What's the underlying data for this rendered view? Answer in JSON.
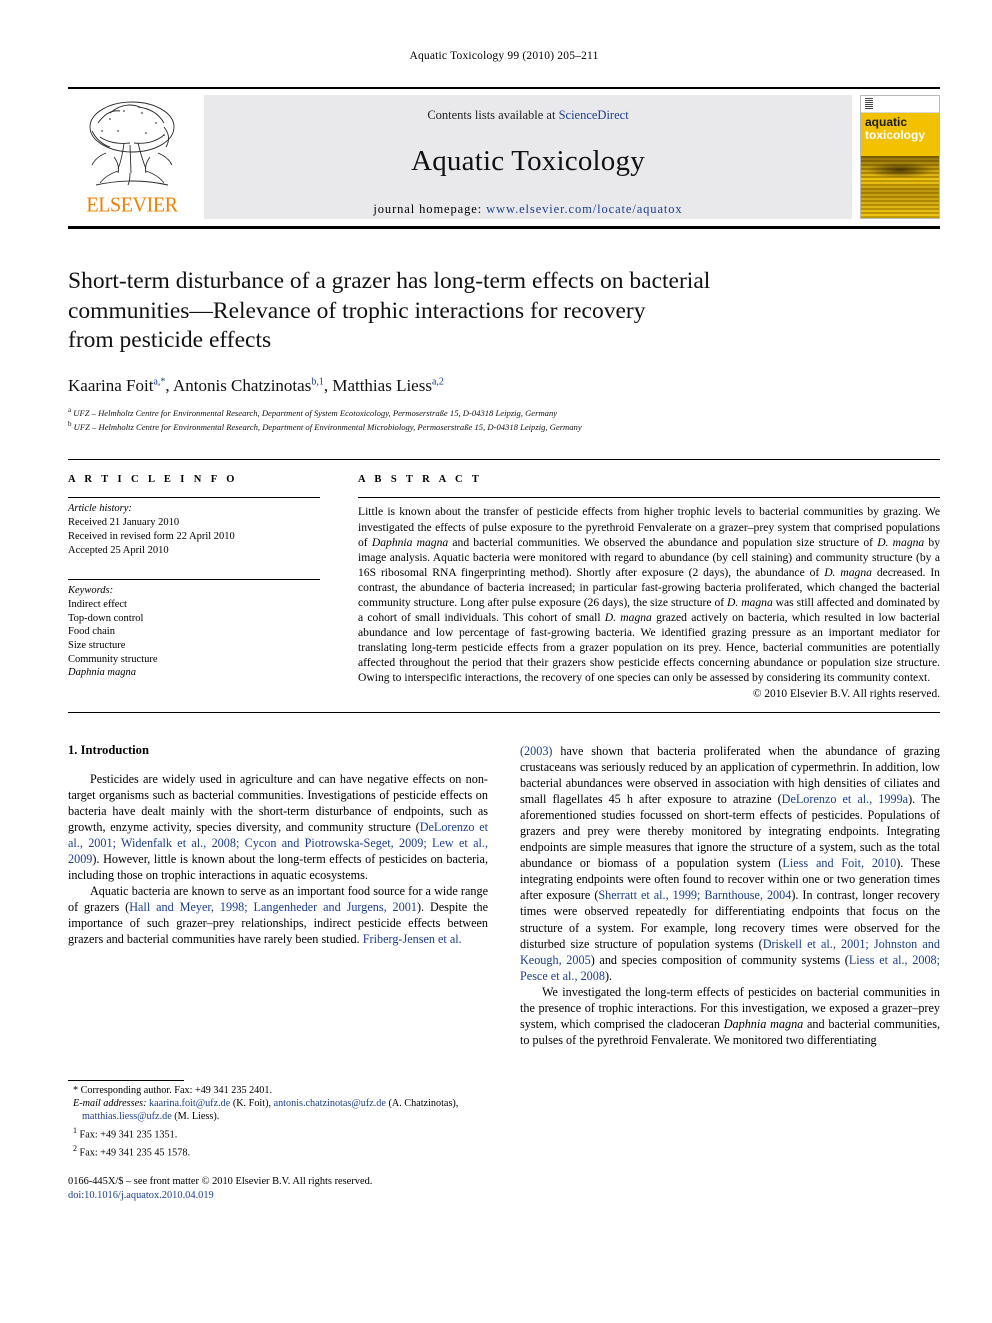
{
  "running_head": "Aquatic Toxicology 99 (2010) 205–211",
  "masthead": {
    "contents_prefix": "Contents lists available at ",
    "sciencedirect": "ScienceDirect",
    "journal_name": "Aquatic Toxicology",
    "homepage_prefix": "journal homepage: ",
    "homepage_url": "www.elsevier.com/locate/aquatox",
    "publisher_logo_text": "ELSEVIER",
    "cover_title_line1": "aquatic",
    "cover_title_line2": "toxicology",
    "link_color": "#1b3e8c",
    "band_color": "#e9e9eb",
    "cover_color": "#f2c200"
  },
  "article": {
    "title_line1": "Short-term disturbance of a grazer has long-term effects on bacterial",
    "title_line2": "communities—Relevance of trophic interactions for recovery",
    "title_line3": "from pesticide effects",
    "authors": [
      {
        "name": "Kaarina Foit",
        "marks": "a,*"
      },
      {
        "name": "Antonis Chatzinotas",
        "marks": "b,1"
      },
      {
        "name": "Matthias Liess",
        "marks": "a,2"
      }
    ],
    "affiliations": [
      {
        "mark": "a",
        "text": "UFZ – Helmholtz Centre for Environmental Research, Department of System Ecotoxicology, Permoserstraße 15, D-04318 Leipzig, Germany"
      },
      {
        "mark": "b",
        "text": "UFZ – Helmholtz Centre for Environmental Research, Department of Environmental Microbiology, Permoserstraße 15, D-04318 Leipzig, Germany"
      }
    ]
  },
  "article_info": {
    "heading": "A R T I C L E   I N F O",
    "history_title": "Article history:",
    "history": [
      "Received 21 January 2010",
      "Received in revised form 22 April 2010",
      "Accepted 25 April 2010"
    ],
    "keywords_title": "Keywords:",
    "keywords": [
      "Indirect effect",
      "Top-down control",
      "Food chain",
      "Size structure",
      "Community structure",
      "Daphnia magna"
    ],
    "keyword_italic_index": 5
  },
  "abstract": {
    "heading": "A B S T R A C T",
    "paragraph_html": "Little is known about the transfer of pesticide effects from higher trophic levels to bacterial communities by grazing. We investigated the effects of pulse exposure to the pyrethroid Fenvalerate on a grazer–prey system that comprised populations of <i>Daphnia magna</i> and bacterial communities. We observed the abundance and population size structure of <i>D. magna</i> by image analysis. Aquatic bacteria were monitored with regard to abundance (by cell staining) and community structure (by a 16S ribosomal RNA fingerprinting method). Shortly after exposure (2 days), the abundance of <i>D. magna</i> decreased. In contrast, the abundance of bacteria increased; in particular fast-growing bacteria proliferated, which changed the bacterial community structure. Long after pulse exposure (26 days), the size structure of <i>D. magna</i> was still affected and dominated by a cohort of small individuals. This cohort of small <i>D. magna</i> grazed actively on bacteria, which resulted in low bacterial abundance and low percentage of fast-growing bacteria. We identified grazing pressure as an important mediator for translating long-term pesticide effects from a grazer population on its prey. Hence, bacterial communities are potentially affected throughout the period that their grazers show pesticide effects concerning abundance or population size structure. Owing to interspecific interactions, the recovery of one species can only be assessed by considering its community context.",
    "copyright": "© 2010 Elsevier B.V. All rights reserved."
  },
  "introduction": {
    "heading": "1.  Introduction",
    "left_paragraphs_html": [
      "Pesticides are widely used in agriculture and can have negative effects on non-target organisms such as bacterial communities. Investigations of pesticide effects on bacteria have dealt mainly with the short-term disturbance of endpoints, such as growth, enzyme activity, species diversity, and community structure (<span class=\"cite\">DeLorenzo et al., 2001; Widenfalk et al., 2008; Cycon and Piotrowska-Seget, 2009; Lew et al., 2009</span>). However, little is known about the long-term effects of pesticides on bacteria, including those on trophic interactions in aquatic ecosystems.",
      "Aquatic bacteria are known to serve as an important food source for a wide range of grazers (<span class=\"cite\">Hall and Meyer, 1998; Langenheder and Jurgens, 2001</span>). Despite the importance of such grazer–prey relationships, indirect pesticide effects between grazers and bacterial communities have rarely been studied. <span class=\"cite\">Friberg-Jensen et al.</span>"
    ],
    "right_paragraphs_html": [
      "<span class=\"cite\">(2003)</span> have shown that bacteria proliferated when the abundance of grazing crustaceans was seriously reduced by an application of cypermethrin. In addition, low bacterial abundances were observed in association with high densities of ciliates and small flagellates 45 h after exposure to atrazine (<span class=\"cite\">DeLorenzo et al., 1999a</span>). The aforementioned studies focussed on short-term effects of pesticides. Populations of grazers and prey were thereby monitored by integrating endpoints. Integrating endpoints are simple measures that ignore the structure of a system, such as the total abundance or biomass of a population system (<span class=\"cite\">Liess and Foit, 2010</span>). These integrating endpoints were often found to recover within one or two generation times after exposure (<span class=\"cite\">Sherratt et al., 1999; Barnthouse, 2004</span>). In contrast, longer recovery times were observed repeatedly for differentiating endpoints that focus on the structure of a system. For example, long recovery times were observed for the disturbed size structure of population systems (<span class=\"cite\">Driskell et al., 2001; Johnston and Keough, 2005</span>) and species composition of community systems (<span class=\"cite\">Liess et al., 2008; Pesce et al., 2008</span>).",
      "We investigated the long-term effects of pesticides on bacterial communities in the presence of trophic interactions. For this investigation, we exposed a grazer–prey system, which comprised the cladoceran <i>Daphnia magna</i> and bacterial communities, to pulses of the pyrethroid Fenvalerate. We monitored two differentiating"
    ]
  },
  "footnotes": {
    "corresponding_html": "* Corresponding author. Fax: +49 341 235 2401.",
    "email_html": "<span class=\"em\">E-mail addresses:</span> <span class=\"cite\">kaarina.foit@ufz.de</span> (K. Foit), <span class=\"cite\">antonis.chatzinotas@ufz.de</span> (A. Chatzinotas), <span class=\"cite\">matthias.liess@ufz.de</span> (M. Liess).",
    "fn1_html": "<sup>1</sup>  Fax: +49 341 235 1351.",
    "fn2_html": "<sup>2</sup>  Fax: +49 341 235 45 1578.",
    "imprint_line1": "0166-445X/$ – see front matter © 2010 Elsevier B.V. All rights reserved.",
    "imprint_doi": "doi:10.1016/j.aquatox.2010.04.019"
  }
}
